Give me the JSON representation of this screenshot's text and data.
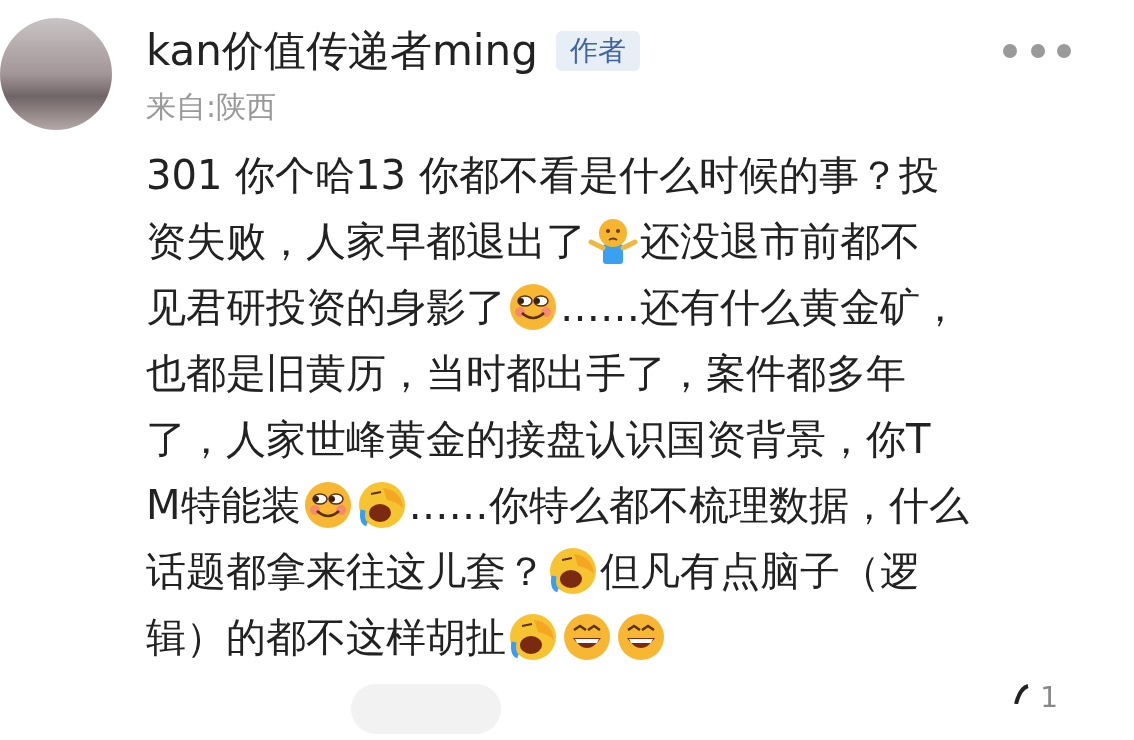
{
  "comment": {
    "author": "kan价值传递者ming",
    "badge": "作者",
    "location": "来自:陕西",
    "lines": [
      [
        {
          "kind": "text",
          "text": "301 你个哈13 你都不看是什么时候的事？投"
        }
      ],
      [
        {
          "kind": "text",
          "text": "资失败，人家早都退出了"
        },
        {
          "kind": "shrug"
        },
        {
          "kind": "text",
          "text": "还没退市前都不"
        }
      ],
      [
        {
          "kind": "text",
          "text": "见君研投资的身影了"
        },
        {
          "kind": "smirk"
        },
        {
          "kind": "text",
          "text": "……还有什么黄金矿，"
        }
      ],
      [
        {
          "kind": "text",
          "text": "也都是旧黄历，当时都出手了，案件都多年"
        }
      ],
      [
        {
          "kind": "text",
          "text": "了，人家世峰黄金的接盘认识国资背景，你T"
        }
      ],
      [
        {
          "kind": "text",
          "text": "M特能装"
        },
        {
          "kind": "smirk"
        },
        {
          "kind": "facepalm"
        },
        {
          "kind": "text",
          "text": "……你特么都不梳理数据，什么"
        }
      ],
      [
        {
          "kind": "text",
          "text": "话题都拿来往这儿套？"
        },
        {
          "kind": "facepalm"
        },
        {
          "kind": "text",
          "text": "但凡有点脑子（逻"
        }
      ],
      [
        {
          "kind": "text",
          "text": "辑）的都不这样胡扯"
        },
        {
          "kind": "facepalm"
        },
        {
          "kind": "grin"
        },
        {
          "kind": "grin"
        }
      ]
    ],
    "like_count": "1"
  }
}
